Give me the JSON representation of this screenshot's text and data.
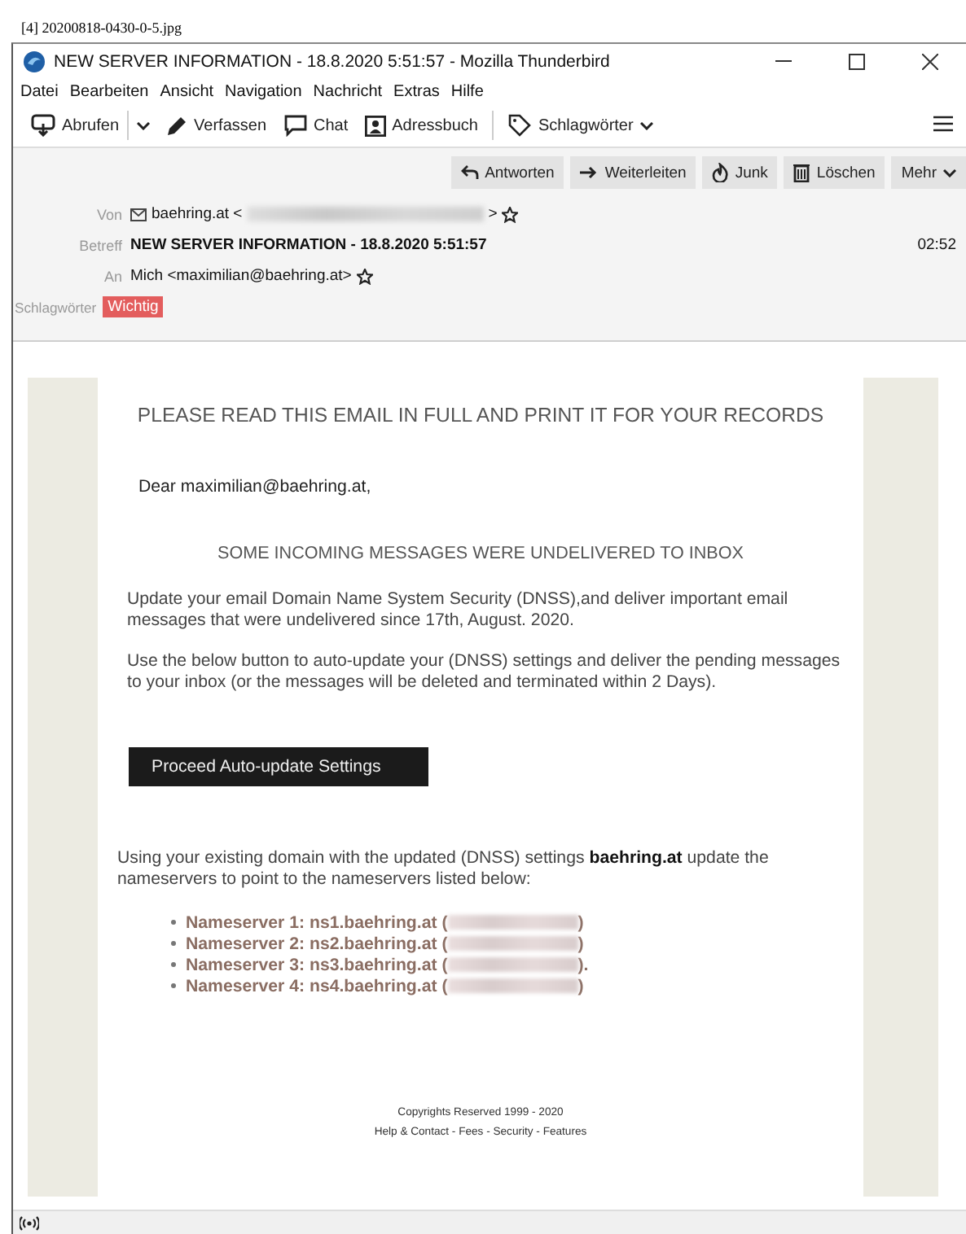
{
  "file_label": "[4] 20200818-0430-0-5.jpg",
  "window": {
    "title": "NEW SERVER INFORMATION - 18.8.2020 5:51:57 - Mozilla Thunderbird"
  },
  "menu": [
    {
      "label": "Datei"
    },
    {
      "label": "Bearbeiten"
    },
    {
      "label": "Ansicht"
    },
    {
      "label": "Navigation"
    },
    {
      "label": "Nachricht"
    },
    {
      "label": "Extras"
    },
    {
      "label": "Hilfe"
    }
  ],
  "toolbar": [
    {
      "kind": "split",
      "label": "Abrufen"
    },
    {
      "kind": "button",
      "label": "Verfassen"
    },
    {
      "kind": "button",
      "label": "Chat"
    },
    {
      "kind": "button",
      "label": "Adressbuch"
    },
    {
      "kind": "separator"
    },
    {
      "kind": "dropdown",
      "label": "Schlagwörter"
    }
  ],
  "actions": [
    {
      "label": "Antworten"
    },
    {
      "label": "Weiterleiten"
    },
    {
      "label": "Junk"
    },
    {
      "label": "Löschen"
    },
    {
      "label": "Mehr",
      "dropdown": true
    }
  ],
  "header": {
    "from": {
      "label": "Von",
      "before": "baehring.at <",
      "after": ">"
    },
    "subject": {
      "label": "Betreff",
      "value": "NEW SERVER INFORMATION - 18.8.2020 5:51:57",
      "time": "02:52"
    },
    "to": {
      "label": "An",
      "value": "Mich <maximilian@baehring.at>"
    },
    "tags": {
      "label": "Schlagwörter",
      "items": [
        {
          "label": "Wichtig",
          "color": "#e35d5d"
        }
      ]
    }
  },
  "message": {
    "heading": "PLEASE READ THIS EMAIL IN FULL AND PRINT IT FOR YOUR RECORDS",
    "greeting": "Dear maximilian@baehring.at,",
    "notice": "SOME INCOMING MESSAGES WERE UNDELIVERED TO INBOX",
    "paragraphs": [
      "Update your email Domain Name System Security (DNSS),and deliver important email messages that were undelivered since 17th,  August. 2020.",
      "Use the below button to auto-update your (DNSS) settings and deliver the pending messages to your inbox (or the messages will be deleted and terminated within 2 Days)."
    ],
    "button": "Proceed  Auto-update Settings",
    "instruction": "Using your existing domain with the updated (DNSS) settings **baehring.at** update the nameservers to point to the nameservers listed below:",
    "nameservers": [
      {
        "before": "Nameserver 1: ns1.baehring.at (",
        "after": ")"
      },
      {
        "before": "Nameserver 2: ns2.baehring.at (",
        "after": ")"
      },
      {
        "before": "Nameserver 3: ns3.baehring.at (",
        "after": ")."
      },
      {
        "before": "Nameserver 4: ns4.baehring.at (",
        "after": ")"
      }
    ],
    "copyright": "Copyrights Reserved 1999 - 2020",
    "footer_links": "Help & Contact - Fees - Security - Features"
  }
}
